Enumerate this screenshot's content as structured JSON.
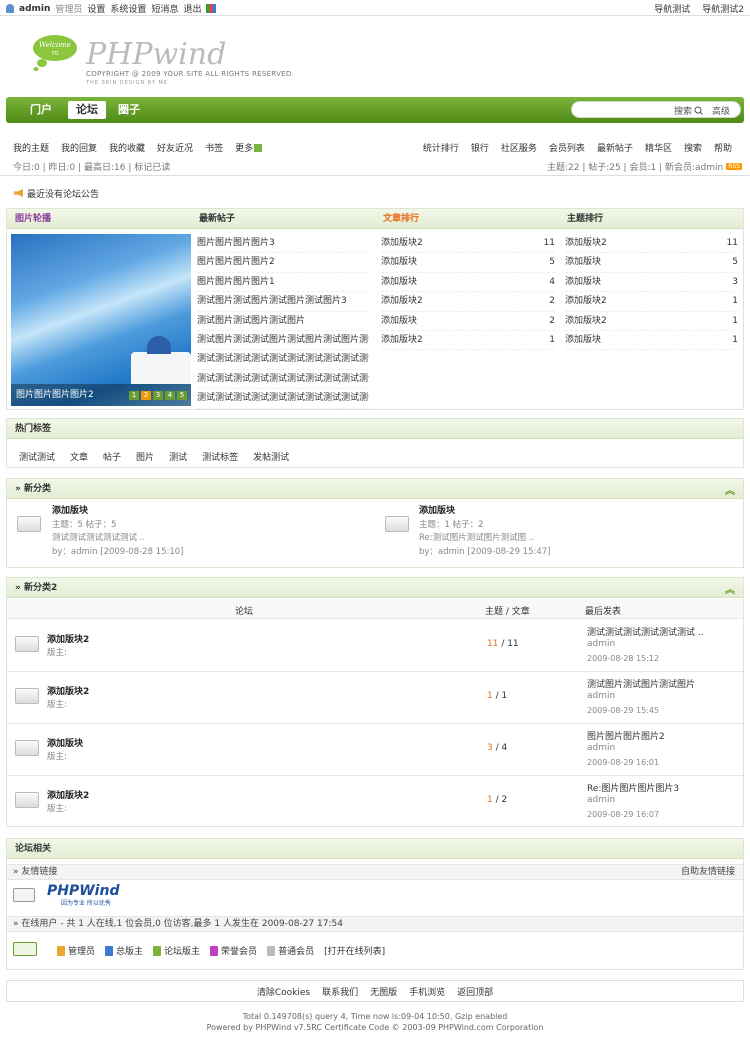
{
  "topbar": {
    "user": "admin",
    "links": [
      "管理员",
      "设置",
      "系统设置",
      "短消息",
      "退出"
    ],
    "right": [
      "导航测试",
      "导航测试2"
    ]
  },
  "header": {
    "welcome": "Welcome TO",
    "logo": "PHPwind",
    "copyright": "COPYRIGHT @ 2009 YOUR SITE ALL RIGHTS RESERVED.",
    "design": "THE SKIN DESIGN BY ME"
  },
  "nav": {
    "tabs": [
      "门户",
      "论坛",
      "圈子"
    ],
    "search_btn": "搜索",
    "advanced": "高级"
  },
  "subnav": {
    "left": [
      "我的主题",
      "我的回复",
      "我的收藏",
      "好友近况",
      "书签",
      "更多"
    ],
    "right": [
      "统计排行",
      "银行",
      "社区服务",
      "会员列表",
      "最新帖子",
      "精华区",
      "搜索",
      "帮助"
    ],
    "stats_left": "今日:0 | 昨日:0 | 最高日:16 | 标记已读",
    "stats_right": "主题:22 | 帖子:25 | 会员:1 | 新会员:admin",
    "rss": "RSS"
  },
  "notice": "最近没有论坛公告",
  "block1": {
    "h_slide": "图片轮播",
    "h_new": "最新帖子",
    "h_art": "文章排行",
    "h_topic": "主题排行",
    "slide_caption": "图片图片图片图片2",
    "slide_dots": [
      "1",
      "2",
      "3",
      "4",
      "5"
    ],
    "new_posts": [
      "图片图片图片图片3",
      "图片图片图片图片2",
      "图片图片图片图片1",
      "测试图片测试图片测试图片测试图片3",
      "测试图片测试图片测试图片",
      "测试图片测试测试图片测试图片测试图片测试图",
      "测试测试测试测试测试测试测试测试测试测试测试测",
      "测试测试测试测试测试测试测试测试测试测试测试测",
      "测试测试测试测试测试测试测试测试测试测试测试测"
    ],
    "art_rank": [
      {
        "n": "添加版块2",
        "v": "11"
      },
      {
        "n": "添加版块",
        "v": "5"
      },
      {
        "n": "添加版块",
        "v": "4"
      },
      {
        "n": "添加版块2",
        "v": "2"
      },
      {
        "n": "添加版块",
        "v": "2"
      },
      {
        "n": "添加版块2",
        "v": "1"
      }
    ],
    "topic_rank": [
      {
        "n": "添加版块2",
        "v": "11"
      },
      {
        "n": "添加版块",
        "v": "5"
      },
      {
        "n": "添加版块",
        "v": "3"
      },
      {
        "n": "添加版块2",
        "v": "1"
      },
      {
        "n": "添加版块2",
        "v": "1"
      },
      {
        "n": "添加版块",
        "v": "1"
      }
    ]
  },
  "tags": {
    "title": "热门标签",
    "items": [
      "测试测试",
      "文章",
      "帖子",
      "图片",
      "测试",
      "测试标签",
      "发帖测试"
    ]
  },
  "cat1": {
    "title": "» 新分类",
    "forums": [
      {
        "name": "添加版块",
        "counts": "主题：5  帖子：5",
        "last": "测试测试测试测试测试 ..",
        "by": "by：admin [2009-08-28 15:10]"
      },
      {
        "name": "添加版块",
        "counts": "主题：1  帖子：2",
        "last": "Re:测试图片测试图片测试图 ..",
        "by": "by：admin [2009-08-29 15:47]"
      }
    ]
  },
  "cat2": {
    "title": "» 新分类2",
    "col_forum": "论坛",
    "col_count": "主题 / 文章",
    "col_last": "最后发表",
    "forums": [
      {
        "name": "添加版块2",
        "mod": "版主:",
        "t": "11",
        "a": " / 11",
        "last": "测试测试测试测试测试测试 ..",
        "user": "admin",
        "time": "2009-08-28 15:12"
      },
      {
        "name": "添加版块2",
        "mod": "版主:",
        "t": "1",
        "a": " / 1",
        "last": "测试图片测试图片测试图片",
        "user": "admin",
        "time": "2009-08-29 15:45"
      },
      {
        "name": "添加版块",
        "mod": "版主:",
        "t": "3",
        "a": " / 4",
        "last": "图片图片图片图片2",
        "user": "admin",
        "time": "2009-08-29 16:01"
      },
      {
        "name": "添加版块2",
        "mod": "版主:",
        "t": "1",
        "a": " / 2",
        "last": "Re:图片图片图片图片3",
        "user": "admin",
        "time": "2009-08-29 16:07"
      }
    ]
  },
  "related": {
    "title": "论坛相关",
    "friend": "» 友情链接",
    "auto": "自助友情链接",
    "pwlogo": "PHPWind",
    "pwslogan": "因为专业 所以优秀",
    "online": "» 在线用户  - 共 1 人在线,1 位会员,0 位访客,最多 1 人发生在 2009-08-27 17:54",
    "legend": [
      {
        "label": "管理员",
        "color": "#e9a632"
      },
      {
        "label": "总版主",
        "color": "#3a7ad0"
      },
      {
        "label": "论坛版主",
        "color": "#7bb43a"
      },
      {
        "label": "荣誉会员",
        "color": "#c040c0"
      },
      {
        "label": "普通会员",
        "color": "#bbbbbb"
      }
    ],
    "open_list": "[打开在线列表]"
  },
  "footer": {
    "links": [
      "清除Cookies",
      "联系我们",
      "无图版",
      "手机浏览",
      "返回顶部"
    ],
    "line1": "Total 0.149708(s) query 4, Time now is:09-04 10:50, Gzip enabled",
    "line2": "Powered by PHPWind v7.5RC Certificate Code © 2003-09 PHPWind.com Corporation"
  }
}
